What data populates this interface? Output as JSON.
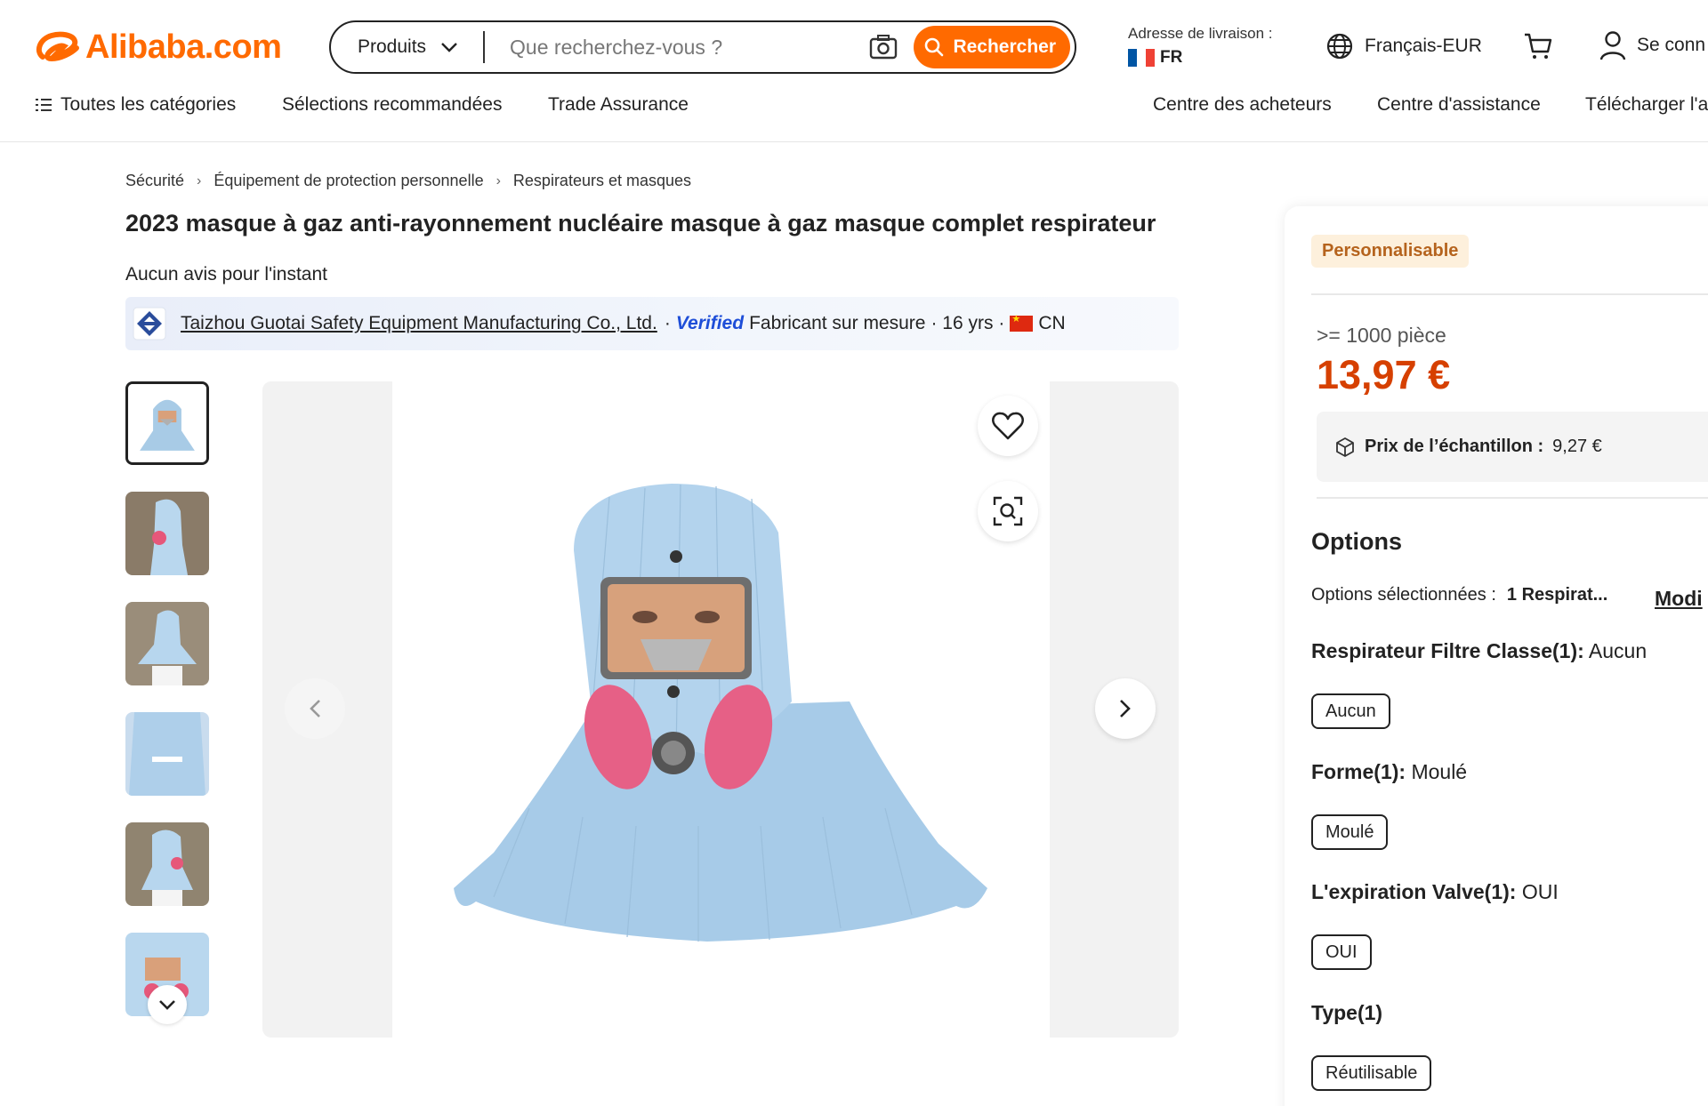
{
  "header": {
    "logo_text": "Alibaba.com",
    "search": {
      "category": "Produits",
      "placeholder": "Que recherchez-vous ?",
      "button_label": "Rechercher"
    },
    "shipping": {
      "label": "Adresse de livraison :",
      "country": "FR"
    },
    "language": "Français-EUR",
    "signin": "Se conn"
  },
  "nav": {
    "all_categories": "Toutes les catégories",
    "recommended": "Sélections recommandées",
    "trade_assurance": "Trade Assurance",
    "buyers_center": "Centre des acheteurs",
    "help_center": "Centre d'assistance",
    "download": "Télécharger l'a"
  },
  "breadcrumb": [
    "Sécurité",
    "Équipement de protection personnelle",
    "Respirateurs et masques"
  ],
  "product": {
    "title": "2023 masque à gaz anti-rayonnement nucléaire masque à gaz masque complet respirateur",
    "reviews": "Aucun avis pour l'instant"
  },
  "supplier": {
    "name": "Taizhou Guotai Safety Equipment Manufacturing Co., Ltd.",
    "sep1": "·",
    "verified": "Verified",
    "type": "Fabricant sur mesure",
    "years": "· 16 yrs ·",
    "country": "CN"
  },
  "gallery": {
    "thumbnail_count": 6,
    "active_index": 0
  },
  "panel": {
    "badge": "Personnalisable",
    "min_qty": ">= 1000 pièce",
    "price": "13,97 €",
    "sample_label": "Prix de l’échantillon :",
    "sample_price": "9,27 €",
    "options_heading": "Options",
    "options_selected_label": "Options sélectionnées :",
    "options_selected_value": "1 Respirat...",
    "modify": "Modi",
    "attributes": [
      {
        "label": "Respirateur Filtre Classe(1):",
        "value": "Aucun",
        "chip": "Aucun"
      },
      {
        "label": "Forme(1):",
        "value": "Moulé",
        "chip": "Moulé"
      },
      {
        "label": "L'expiration Valve(1):",
        "value": "OUI",
        "chip": "OUI"
      },
      {
        "label": "Type(1)",
        "value": "",
        "chip": "Réutilisable"
      }
    ]
  },
  "colors": {
    "brand_orange": "#ff6a00",
    "price_red": "#d64000",
    "badge_bg": "#fdf0dc",
    "badge_text": "#b5631d",
    "verified_blue": "#1e4ed8"
  }
}
